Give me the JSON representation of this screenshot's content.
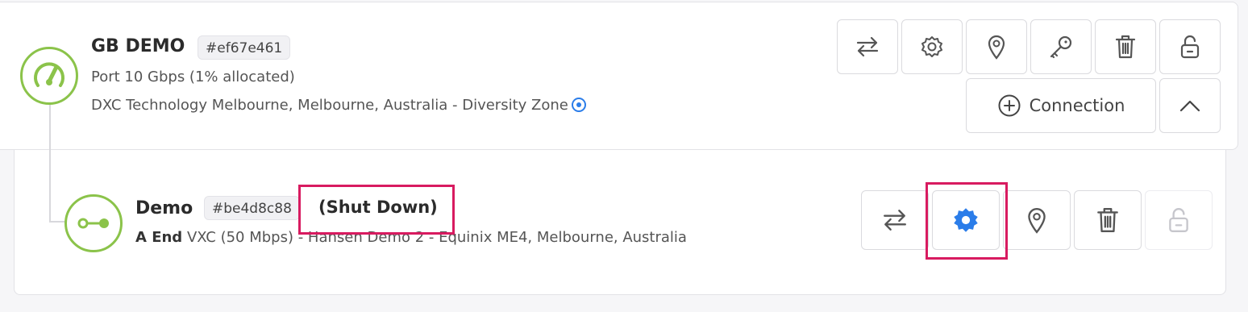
{
  "port": {
    "name": "GB DEMO",
    "uid": "#ef67e461",
    "speed": "Port 10 Gbps (1% allocated)",
    "location": "DXC Technology Melbourne, Melbourne, Australia - Diversity Zone",
    "actions": [
      "transfer-icon",
      "settings-icon",
      "location-pin-icon",
      "key-icon",
      "delete-icon",
      "unlock-icon"
    ],
    "connection_label": "Connection"
  },
  "vxc": {
    "name": "Demo",
    "uid": "#be4d8c88",
    "status": "(Shut Down)",
    "end_label": "A End",
    "details": "VXC (50 Mbps) - Hansen Demo 2 - Equinix ME4, Melbourne, Australia",
    "actions": [
      "transfer-icon",
      "settings-icon",
      "location-pin-icon",
      "delete-icon",
      "unlock-icon"
    ]
  },
  "colors": {
    "brand_green": "#8bc34a",
    "highlight": "#d81b60",
    "accent_blue": "#2b7de9"
  }
}
